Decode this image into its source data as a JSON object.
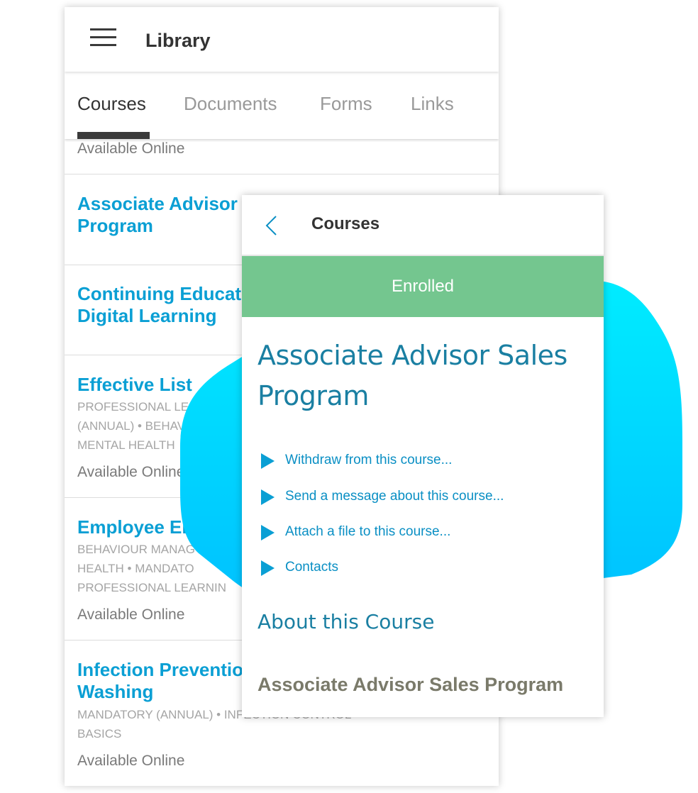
{
  "library": {
    "title": "Library",
    "tabs": [
      {
        "label": "Courses",
        "active": true
      },
      {
        "label": "Documents",
        "active": false
      },
      {
        "label": "Forms",
        "active": false
      },
      {
        "label": "Links",
        "active": false
      }
    ],
    "partial_top_status": "Available Online",
    "courses": [
      {
        "title_lines": [
          "Associate Advisor",
          "Program"
        ]
      },
      {
        "title_lines": [
          "Continuing Educat",
          "Digital Learning"
        ]
      },
      {
        "title_lines": [
          "Effective List"
        ],
        "category_lines": [
          "PROFESSIONAL LE",
          "(ANNUAL) • BEHAV",
          "MENTAL HEALTH"
        ],
        "status": "Available Online"
      },
      {
        "title_lines": [
          "Employee En"
        ],
        "category_lines": [
          "BEHAVIOUR MANAG",
          "HEALTH • MANDATO",
          "PROFESSIONAL LEARNIN"
        ],
        "status": "Available Online"
      },
      {
        "title_lines": [
          "Infection Preventio",
          "Washing"
        ],
        "category_lines": [
          "MANDATORY (ANNUAL) • INFECTION CONTROL",
          "BASICS"
        ],
        "status": "Available Online"
      }
    ]
  },
  "detail": {
    "header_title": "Courses",
    "enrolled_banner": "Enrolled",
    "course_name_lines": [
      "Associate Advisor Sales",
      "Program"
    ],
    "actions": [
      {
        "label": "Withdraw from this course..."
      },
      {
        "label": "Send a message about this course..."
      },
      {
        "label": "Attach a file to this course..."
      },
      {
        "label": "Contacts"
      }
    ],
    "about_heading": "About this Course",
    "about_title": "Associate Advisor Sales Program"
  },
  "colors": {
    "accent_blue": "#0a9fd4",
    "enrolled_green": "#74c68f",
    "blob_cyan": "#00e5ff"
  },
  "icons": [
    "hamburger-menu-icon",
    "chevron-left-icon",
    "play-triangle-icon"
  ]
}
